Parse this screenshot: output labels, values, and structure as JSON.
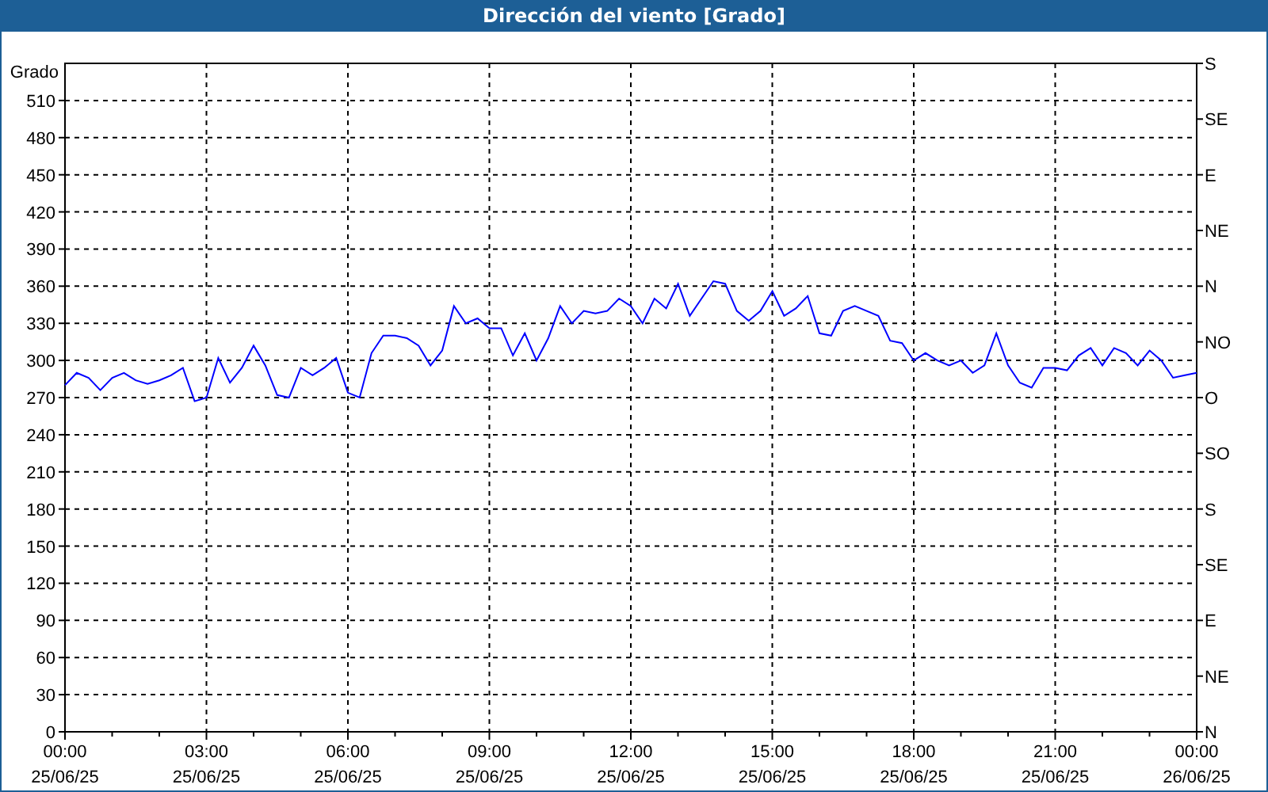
{
  "window": {
    "title": "Dirección del viento [Grado]"
  },
  "chart": {
    "chart_data": {
      "type": "line",
      "grid": true,
      "ylabel": "Grado",
      "ylim": [
        0,
        540
      ],
      "categories": [
        "00:00 25/06/25",
        null,
        null,
        null,
        null,
        null,
        null,
        null,
        null,
        null,
        null,
        null,
        "03:00 25/06/25",
        null,
        null,
        null,
        null,
        null,
        null,
        null,
        null,
        null,
        null,
        null,
        "06:00 25/06/25",
        null,
        null,
        null,
        null,
        null,
        null,
        null,
        null,
        null,
        null,
        null,
        "09:00 25/06/25",
        null,
        null,
        null,
        null,
        null,
        null,
        null,
        null,
        null,
        null,
        null,
        "12:00 25/06/25",
        null,
        null,
        null,
        null,
        null,
        null,
        null,
        null,
        null,
        null,
        null,
        "15:00 25/06/25",
        null,
        null,
        null,
        null,
        null,
        null,
        null,
        null,
        null,
        null,
        null,
        "18:00 25/06/25",
        null,
        null,
        null,
        null,
        null,
        null,
        null,
        null,
        null,
        null,
        null,
        "21:00 25/06/25",
        null,
        null,
        null,
        null,
        null,
        null,
        null,
        null,
        null,
        null,
        null,
        "00:00 26/06/25"
      ],
      "series": [
        {
          "color": "#0000ff",
          "values": [
            280,
            290,
            286,
            276,
            286,
            290,
            284,
            281,
            284,
            288,
            294,
            267,
            270,
            302,
            282,
            294,
            312,
            296,
            272,
            270,
            294,
            288,
            294,
            302,
            274,
            270,
            306,
            320,
            320,
            318,
            312,
            296,
            308,
            344,
            330,
            334,
            326,
            326,
            304,
            322,
            300,
            318,
            344,
            330,
            340,
            338,
            340,
            350,
            344,
            330,
            350,
            342,
            362,
            336,
            350,
            364,
            362,
            340,
            332,
            340,
            356,
            336,
            342,
            352,
            322,
            320,
            340,
            344,
            340,
            336,
            316,
            314,
            300,
            306,
            300,
            296,
            300,
            290,
            296,
            322,
            296,
            282,
            278,
            294,
            294,
            292,
            304,
            310,
            296,
            310,
            306,
            296,
            308,
            300,
            286,
            288,
            290
          ]
        }
      ],
      "yticks": [
        0,
        30,
        60,
        90,
        120,
        150,
        180,
        210,
        240,
        270,
        300,
        330,
        360,
        390,
        420,
        450,
        480,
        510
      ]
    },
    "compass_labels": [
      "S",
      "SE",
      "E",
      "NE",
      "N",
      "NO",
      "O",
      "SO",
      "S",
      "SE",
      "E",
      "NE",
      "N"
    ]
  }
}
